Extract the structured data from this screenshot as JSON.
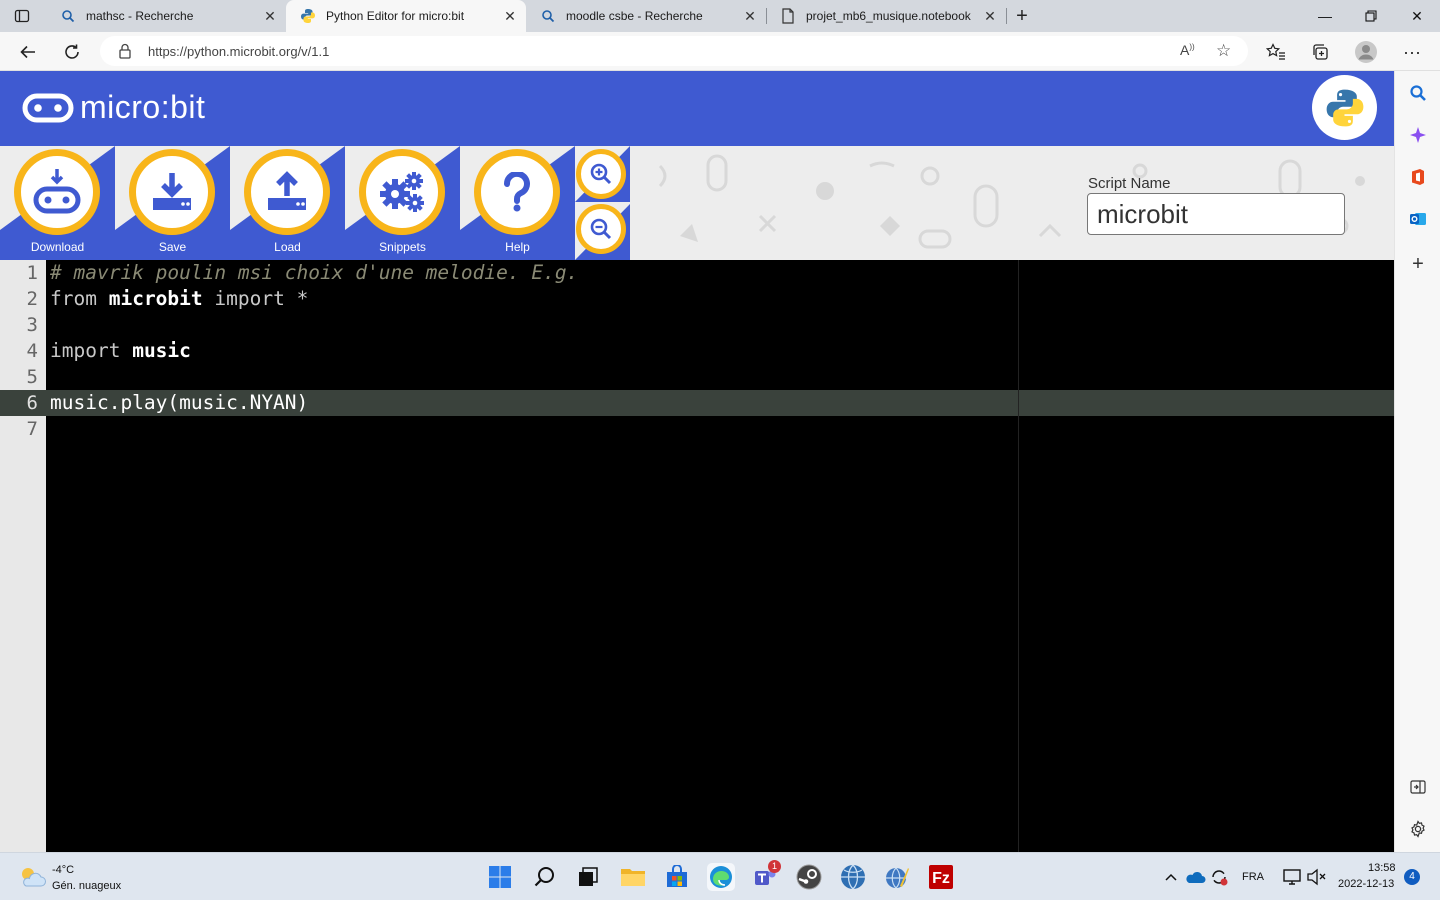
{
  "browser": {
    "tabs": [
      {
        "title": "mathsc - Recherche",
        "icon": "search-icon",
        "active": false
      },
      {
        "title": "Python Editor for micro:bit",
        "icon": "python-icon",
        "active": true
      },
      {
        "title": "moodle csbe - Recherche",
        "icon": "search-icon",
        "active": false
      },
      {
        "title": "projet_mb6_musique.notebook",
        "icon": "document-icon",
        "active": false
      }
    ],
    "url": "https://python.microbit.org/v/1.1"
  },
  "app": {
    "logo_text": "micro:bit",
    "toolbar": {
      "download": "Download",
      "save": "Save",
      "load": "Load",
      "snippets": "Snippets",
      "help": "Help"
    },
    "script_name_label": "Script Name",
    "script_name_value": "microbit",
    "colors": {
      "brand_blue": "#3f5ad1",
      "accent_yellow": "#f8b51a"
    }
  },
  "editor": {
    "line_numbers": [
      "1",
      "2",
      "3",
      "4",
      "5",
      "6",
      "7"
    ],
    "active_line": 6,
    "lines": {
      "l1": "# mavrik poulin msi choix d'une melodie. E.g.",
      "l2_kw1": "from",
      "l2_mod": "microbit",
      "l2_kw2": "import",
      "l2_rest": "*",
      "l4_kw": "import",
      "l4_mod": "music",
      "l6": "music.play(music.NYAN)"
    }
  },
  "taskbar": {
    "weather_temp": "-4°C",
    "weather_desc": "Gén. nuageux",
    "language": "FRA",
    "time": "13:58",
    "date": "2022-12-13",
    "notification_count": "4",
    "teams_badge": "1"
  }
}
